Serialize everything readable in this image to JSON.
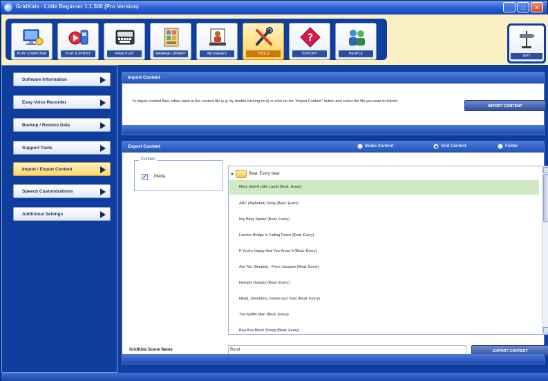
{
  "window": {
    "title": "GridKids - Little Beginner 1.1.500 (Pro Version)",
    "controls": {
      "minimize": "_",
      "maximize": "□",
      "close": "×"
    }
  },
  "toolbar": {
    "tools": [
      {
        "label": "PLAY COMPUTER",
        "icon": "computer-screen-icon",
        "active": false
      },
      {
        "label": "PLAY & SPRINT",
        "icon": "play-paint-icon",
        "active": false
      },
      {
        "label": "FREE PLAY",
        "icon": "keyboard-icon",
        "active": false
      },
      {
        "label": "MANAGE LIBRARY",
        "icon": "library-grid-icon",
        "active": false
      },
      {
        "label": "MESSAGES",
        "icon": "person-board-icon",
        "active": false
      },
      {
        "label": "TOOLS",
        "icon": "tools-icon",
        "active": true
      },
      {
        "label": "HISTORY",
        "icon": "diamond-question-icon",
        "active": false
      },
      {
        "label": "PEOPLE",
        "icon": "people-icon",
        "active": false
      }
    ],
    "right_tool": {
      "label": "EXIT",
      "icon": "signpost-icon"
    }
  },
  "sidebar": {
    "items": [
      {
        "label": "Software Information",
        "active": false
      },
      {
        "label": "Easy Voice Recorder",
        "active": false
      },
      {
        "label": "Backup / Restore Data",
        "active": false
      },
      {
        "label": "Support Tools",
        "active": false
      },
      {
        "label": "Import / Export Content",
        "active": true
      },
      {
        "label": "Speech Customizations",
        "active": false
      },
      {
        "label": "Additional Settings",
        "active": false
      }
    ]
  },
  "import_panel": {
    "title": "Import Content",
    "description": "To import content files, either open in the content file (e.g. by double-clicking on it) or click on the \"Import Content\" button and select the file you want to import.",
    "button": "IMPORT CONTENT"
  },
  "export_panel": {
    "title": "Export Content",
    "radio_options": [
      {
        "label": "Media Content",
        "selected": false
      },
      {
        "label": "Grid Content",
        "selected": true
      },
      {
        "label": "Folder",
        "selected": false
      }
    ],
    "content_group": {
      "legend": "Content",
      "checkbox_label": "Media",
      "checked": true,
      "check_glyph": "✓"
    },
    "tree": {
      "root": "Beat: Every beat",
      "items": [
        "Mary Had A Little Lamb (Beat: Every)",
        "ABC (Alphabet) Song (Beat: Every)",
        "Itsy Bitsy Spider (Beat: Every)",
        "London Bridge Is Falling Down (Beat: Every)",
        "If You're Happy And You Know It (Beat: Every)",
        "Are You Sleeping - Frere Jacques (Beat: Every)",
        "Humpty Dumpty (Beat: Every)",
        "Head, Shoulders, Knees and Toes (Beat: Every)",
        "The Muffin Man (Beat: Every)",
        "Baa Baa Black Sheep (Beat: Every)"
      ],
      "selected_index": 0
    },
    "scene_name_label": "GridKids Scene Name",
    "scene_name_value": "Rend",
    "export_button": "EXPORT CONTENT"
  }
}
